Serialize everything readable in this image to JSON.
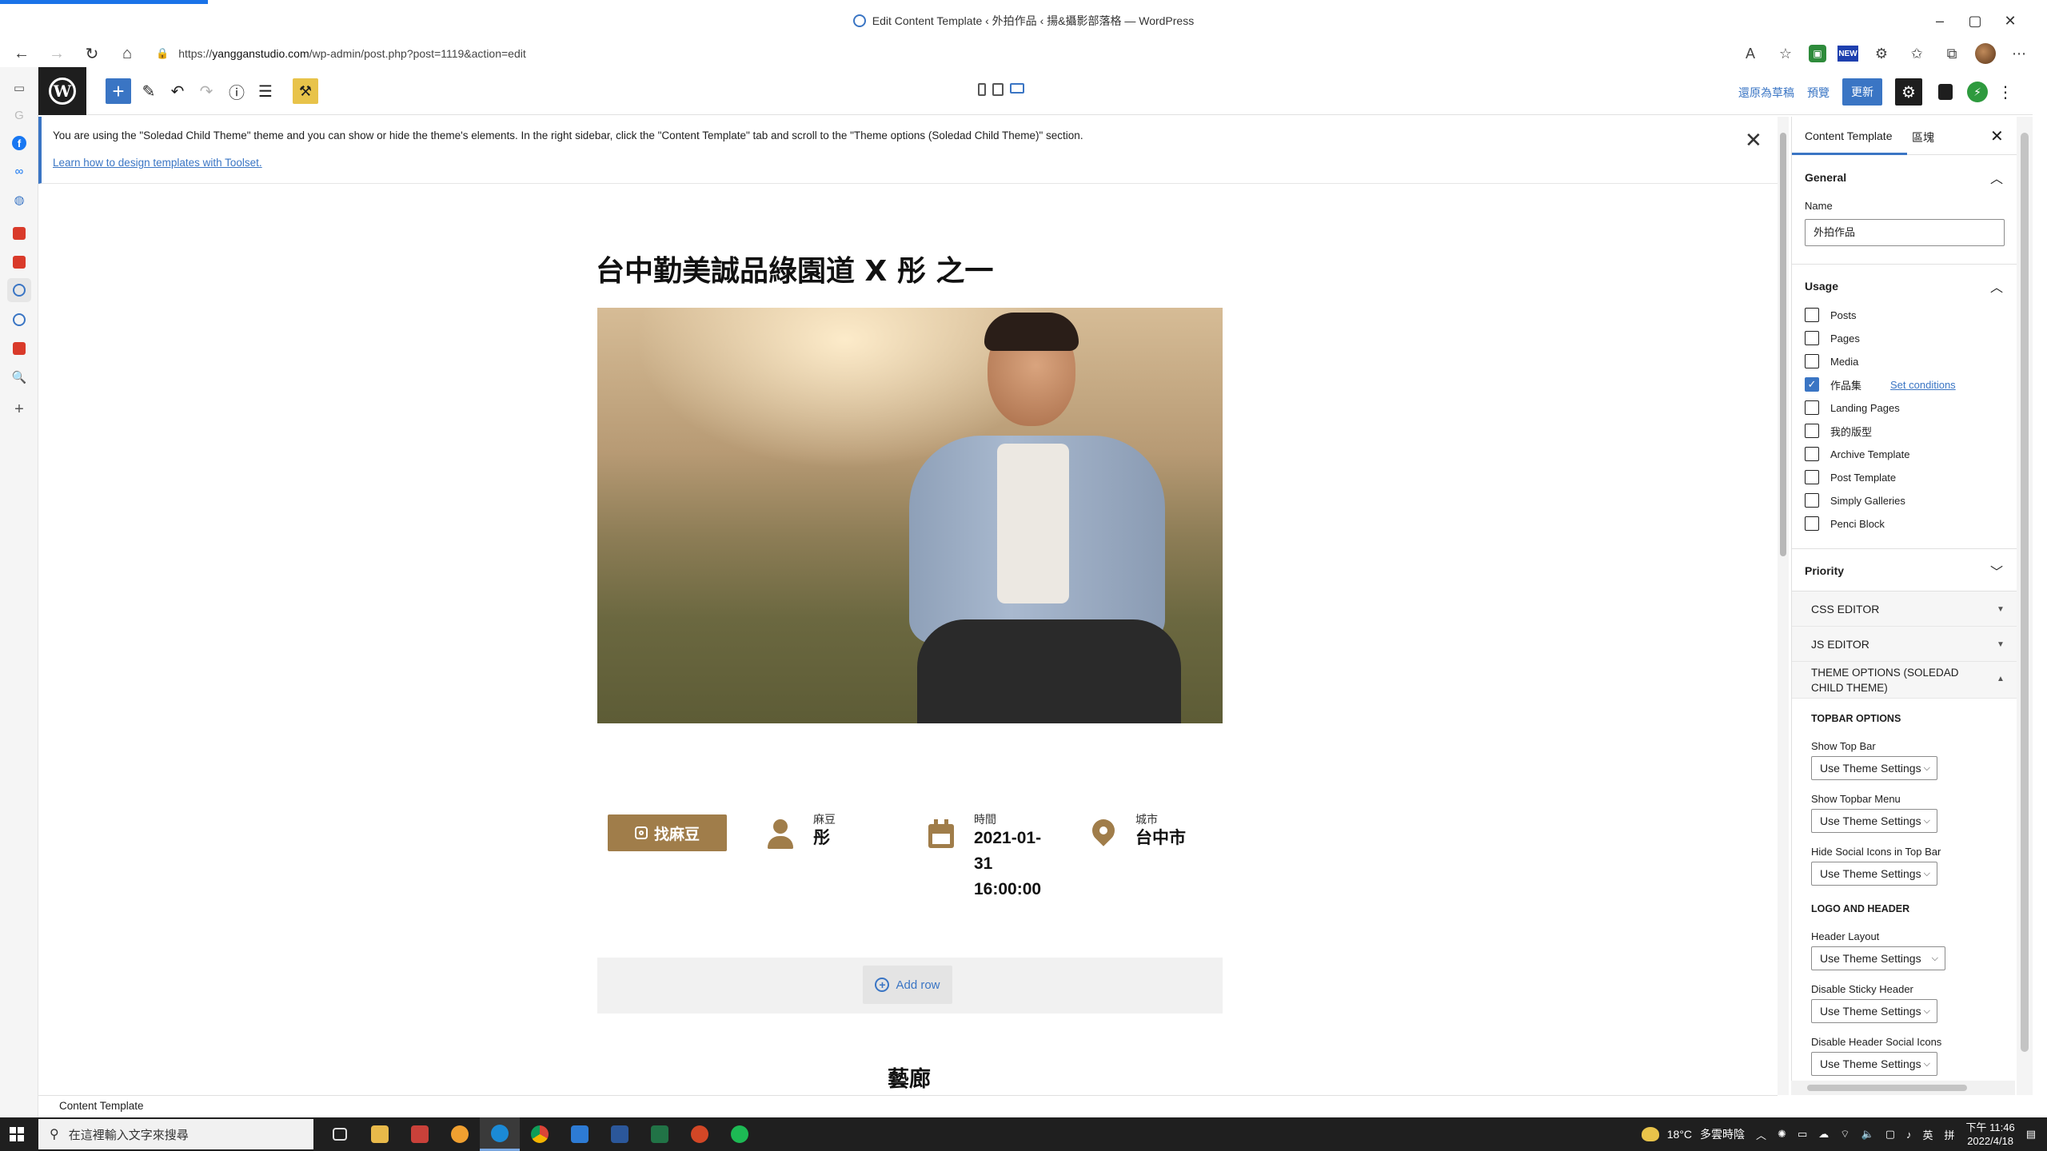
{
  "browser": {
    "title": "Edit Content Template ‹ 外拍作品 ‹ 揚&攝影部落格 — WordPress",
    "url_scheme": "https://",
    "url_host": "yangganstudio.com",
    "url_path": "/wp-admin/post.php?post=1119&action=edit",
    "ext_news": "NEW"
  },
  "wp_toolbar": {
    "switch_draft": "還原為草稿",
    "preview": "預覽",
    "update": "更新"
  },
  "notice": {
    "message": "You are using the \"Soledad Child Theme\" theme and you can show or hide the theme's elements. In the right sidebar, click the \"Content Template\" tab and scroll to the \"Theme options (Soledad Child Theme)\" section.",
    "link": "Learn how to design templates with Toolset."
  },
  "post": {
    "title": "台中勤美誠品綠園道 X 彤 之一",
    "book_button": "找麻豆",
    "meta": {
      "model_label": "麻豆",
      "model_value": "彤",
      "time_label": "時間",
      "time_line1": "2021-01-",
      "time_line2": "31",
      "time_line3": "16:00:00",
      "city_label": "城市",
      "city_value": "台中市"
    },
    "add_row": "Add row",
    "gallery_title": "藝廊"
  },
  "footer": {
    "breadcrumb": "Content Template"
  },
  "sidebar": {
    "tab_active": "Content Template",
    "tab_block": "區塊",
    "general": {
      "heading": "General",
      "name_label": "Name",
      "name_value": "外拍作品"
    },
    "usage": {
      "heading": "Usage",
      "set_conditions": "Set conditions",
      "items": [
        {
          "label": "Posts",
          "checked": false
        },
        {
          "label": "Pages",
          "checked": false
        },
        {
          "label": "Media",
          "checked": false
        },
        {
          "label": "作品集",
          "checked": true
        },
        {
          "label": "Landing Pages",
          "checked": false
        },
        {
          "label": "我的版型",
          "checked": false
        },
        {
          "label": "Archive Template",
          "checked": false
        },
        {
          "label": "Post Template",
          "checked": false
        },
        {
          "label": "Simply Galleries",
          "checked": false
        },
        {
          "label": "Penci Block",
          "checked": false
        }
      ]
    },
    "priority": {
      "heading": "Priority"
    },
    "css_editor": "CSS EDITOR",
    "js_editor": "JS EDITOR",
    "theme_options_line1": "THEME OPTIONS (SOLEDAD",
    "theme_options_line2": "CHILD THEME)",
    "topbar_options": "TOPBAR OPTIONS",
    "logo_header": "LOGO AND HEADER",
    "selects": [
      {
        "label": "Show Top Bar",
        "value": "Use Theme Settings"
      },
      {
        "label": "Show Topbar Menu",
        "value": "Use Theme Settings"
      },
      {
        "label": "Hide Social Icons in Top Bar",
        "value": "Use Theme Settings"
      },
      {
        "label": "Header Layout",
        "value": "Use Theme Settings"
      },
      {
        "label": "Disable Sticky Header",
        "value": "Use Theme Settings"
      },
      {
        "label": "Disable Header Social Icons",
        "value": "Use Theme Settings"
      }
    ]
  },
  "taskbar": {
    "search_placeholder": "在這裡輸入文字來搜尋",
    "temperature": "18°C",
    "weather": "多雲時陰",
    "ime_lang": "英",
    "ime_mode": "拼",
    "time": "下午 11:46",
    "date": "2022/4/18"
  }
}
